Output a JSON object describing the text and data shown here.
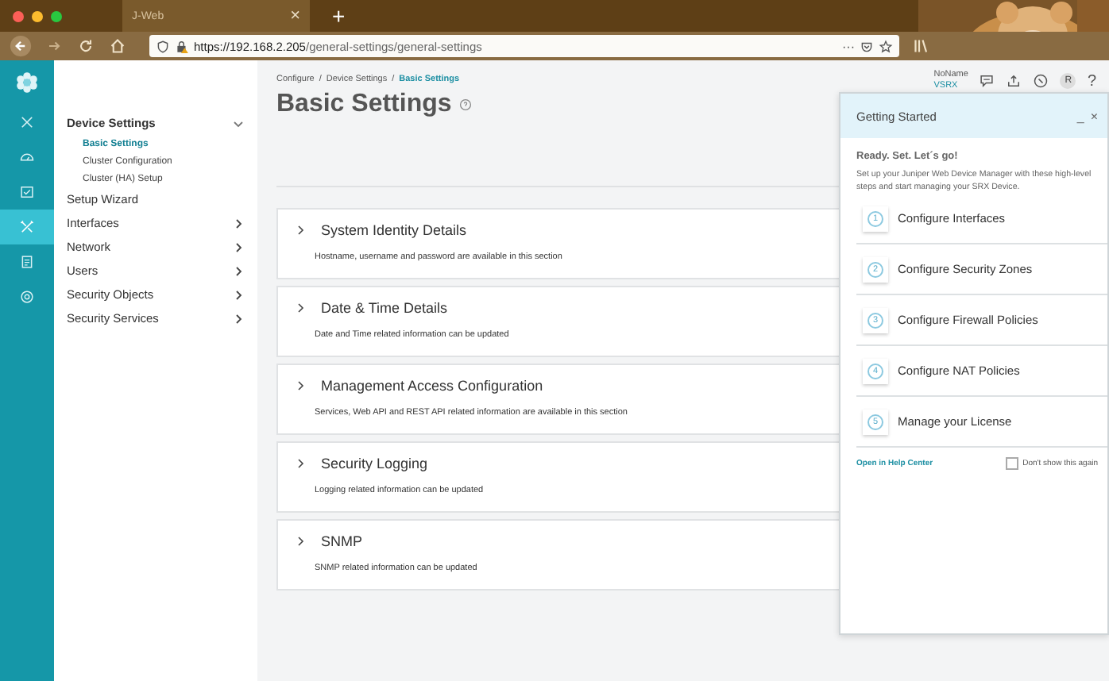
{
  "browser": {
    "tab_title": "J-Web",
    "tab_close": "×",
    "new_tab": "+",
    "url_host": "https://192.168.2.205",
    "url_path": "/general-settings/general-settings",
    "menu_dots": "···"
  },
  "rail": [
    {
      "kind": "close",
      "selected": false
    },
    {
      "kind": "dashboard",
      "selected": false
    },
    {
      "kind": "monitor",
      "selected": false
    },
    {
      "kind": "configure",
      "selected": true
    },
    {
      "kind": "reports",
      "selected": false
    },
    {
      "kind": "admin",
      "selected": false
    }
  ],
  "nav": [
    {
      "label": "Device Settings",
      "expanded": true,
      "children": [
        {
          "label": "Basic Settings",
          "selected": true
        },
        {
          "label": "Cluster Configuration",
          "selected": false
        },
        {
          "label": "Cluster (HA) Setup",
          "selected": false
        }
      ]
    },
    {
      "label": "Setup Wizard"
    },
    {
      "label": "Interfaces",
      "expanded": false
    },
    {
      "label": "Network",
      "expanded": false
    },
    {
      "label": "Users",
      "expanded": false
    },
    {
      "label": "Security Objects",
      "expanded": false
    },
    {
      "label": "Security Services",
      "expanded": false
    }
  ],
  "breadcrumb": [
    {
      "label": "Configure",
      "current": false
    },
    {
      "label": "Device Settings",
      "current": false
    },
    {
      "label": "Basic Settings",
      "current": true
    }
  ],
  "breadcrumb_separator": "/",
  "user": {
    "name": "NoName",
    "device": "VSRX",
    "avatar": "R",
    "help": "?"
  },
  "page_title": "Basic Settings",
  "sections": [
    {
      "title": "System Identity Details",
      "description": "Hostname, username and password are available in this section",
      "expanded": false
    },
    {
      "title": "Date & Time Details",
      "description": "Date and Time related information can be updated",
      "expanded": false
    },
    {
      "title": "Management Access Configuration",
      "description": "Services, Web API and REST API related information are available in this section",
      "expanded": false
    },
    {
      "title": "Security Logging",
      "description": "Logging related information can be updated",
      "expanded": false
    },
    {
      "title": "SNMP",
      "description": "SNMP related information can be updated",
      "expanded": false
    }
  ],
  "panel": {
    "title": "Getting Started",
    "minimize": "_",
    "close": "×",
    "heading": "Ready. Set. Let´s go!",
    "intro": "Set up your Juniper Web Device Manager with these high-level steps and start managing your SRX Device.",
    "steps": [
      {
        "number": "1",
        "label": "Configure Interfaces"
      },
      {
        "number": "2",
        "label": "Configure Security Zones"
      },
      {
        "number": "3",
        "label": "Configure Firewall Policies"
      },
      {
        "number": "4",
        "label": "Configure NAT Policies"
      },
      {
        "number": "5",
        "label": "Manage your License"
      }
    ],
    "link": "Open in Help Center",
    "checkbox": {
      "label": "Don't show this again",
      "checked": false
    }
  }
}
